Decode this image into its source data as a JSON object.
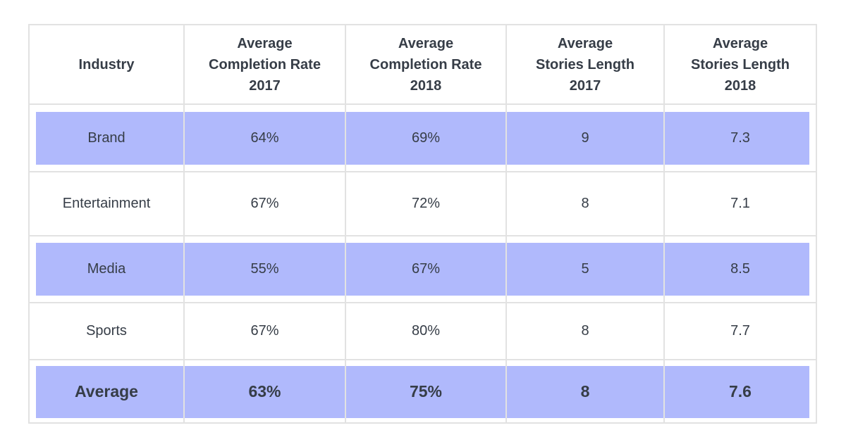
{
  "table": {
    "headers": [
      {
        "lines": [
          "Industry"
        ]
      },
      {
        "lines": [
          "Average",
          "Completion Rate",
          "2017"
        ]
      },
      {
        "lines": [
          "Average",
          "Completion Rate",
          "2018"
        ]
      },
      {
        "lines": [
          "Average",
          "Stories Length",
          "2017"
        ]
      },
      {
        "lines": [
          "Average",
          "Stories Length",
          "2018"
        ]
      }
    ],
    "rows": [
      {
        "industry": "Brand",
        "cr2017": "64%",
        "cr2018": "69%",
        "sl2017": "9",
        "sl2018": "7.3",
        "highlighted": true
      },
      {
        "industry": "Entertainment",
        "cr2017": "67%",
        "cr2018": "72%",
        "sl2017": "8",
        "sl2018": "7.1",
        "highlighted": false
      },
      {
        "industry": "Media",
        "cr2017": "55%",
        "cr2018": "67%",
        "sl2017": "5",
        "sl2018": "8.5",
        "highlighted": true
      },
      {
        "industry": "Sports",
        "cr2017": "67%",
        "cr2018": "80%",
        "sl2017": "8",
        "sl2018": "7.7",
        "highlighted": false
      }
    ],
    "average": {
      "industry": "Average",
      "cr2017": "63%",
      "cr2018": "75%",
      "sl2017": "8",
      "sl2018": "7.6",
      "highlighted": true
    }
  },
  "colors": {
    "highlight": "#b0b9fc",
    "grid": "#e2e2e2",
    "text": "#363d47"
  }
}
